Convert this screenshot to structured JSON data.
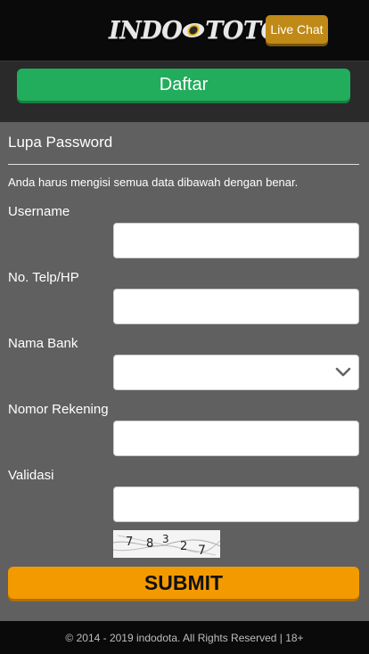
{
  "header": {
    "logo_text_left": "INDO",
    "logo_text_right": "TOTO",
    "live_chat_label": "Live Chat"
  },
  "register_button": "Daftar",
  "form": {
    "title": "Lupa Password",
    "note": "Anda harus mengisi semua data dibawah dengan benar.",
    "fields": [
      {
        "label": "Username",
        "value": ""
      },
      {
        "label": "No. Telp/HP",
        "value": ""
      },
      {
        "label": "Nama Bank",
        "value": ""
      },
      {
        "label": "Nomor Rekening",
        "value": ""
      },
      {
        "label": "Validasi",
        "value": ""
      }
    ],
    "captcha_digits": [
      "7",
      "8",
      "3",
      "2",
      "7"
    ],
    "submit_label": "SUBMIT"
  },
  "footer": {
    "text": "© 2014 - 2019 indodota. All Rights Reserved | 18+"
  },
  "colors": {
    "register": "#22ad5c",
    "submit": "#f39a00",
    "live_chat": "#c08a18",
    "page_bg": "#606060"
  }
}
